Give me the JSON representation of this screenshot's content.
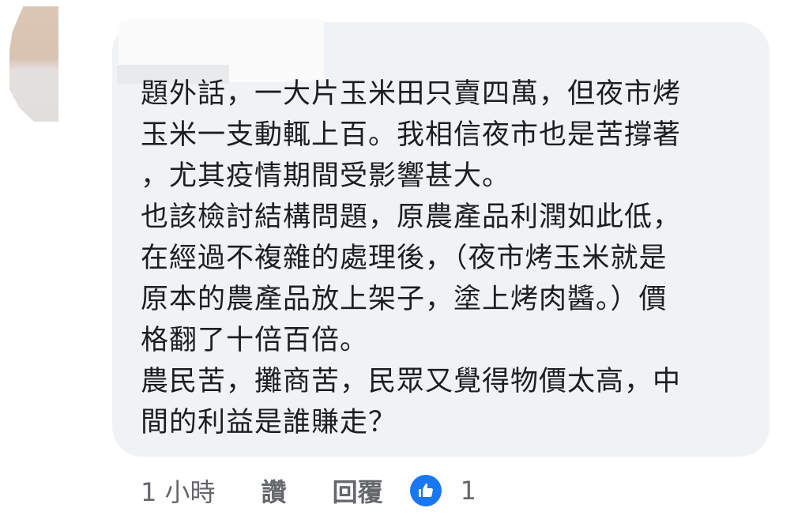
{
  "comment": {
    "lines": [
      "題外話，一大片玉米田只賣四萬，但夜市烤",
      "玉米一支動輒上百。我相信夜市也是苦撐著",
      "，尤其疫情期間受影響甚大。",
      "也該檢討結構問題，原農產品利潤如此低，",
      "在經過不複雜的處理後，（夜市烤玉米就是",
      "原本的農產品放上架子，塗上烤肉醬。）價",
      "格翻了十倍百倍。",
      "農民苦，攤商苦，民眾又覺得物價太高，中",
      "間的利益是誰賺走？"
    ]
  },
  "meta": {
    "time": "1 小時",
    "like_label": "讚",
    "reply_label": "回覆",
    "reaction_count": "1",
    "reaction_icon": "thumbs-up-icon",
    "reaction_color": "#1877f2"
  }
}
